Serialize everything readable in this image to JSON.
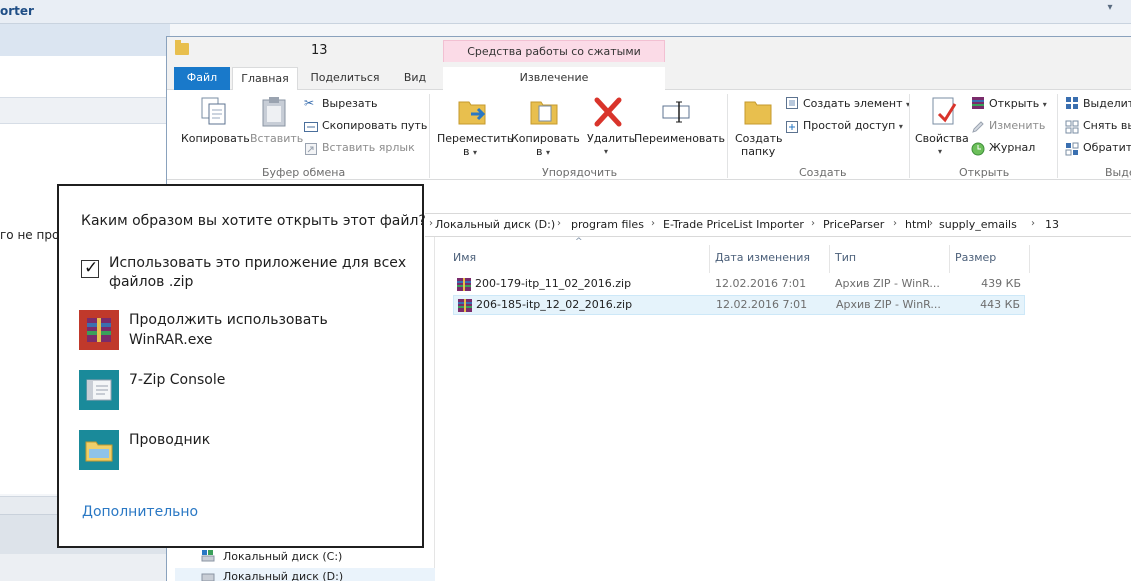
{
  "background_app": {
    "title": "orter",
    "truncated_text": "го не про"
  },
  "explorer": {
    "title": "13",
    "context_tab_header": "Средства работы со сжатыми папками",
    "tabs": {
      "file": "Файл",
      "home": "Главная",
      "share": "Поделиться",
      "view": "Вид",
      "extract": "Извлечение"
    },
    "ribbon": {
      "clipboard": {
        "copy": "Копировать",
        "paste": "Вставить",
        "cut": "Вырезать",
        "copy_path": "Скопировать путь",
        "paste_shortcut": "Вставить ярлык",
        "group": "Буфер обмена"
      },
      "organize": {
        "move_to_line1": "Переместить",
        "move_to_line2": "в",
        "copy_to_line1": "Копировать",
        "copy_to_line2": "в",
        "delete": "Удалить",
        "rename": "Переименовать",
        "group": "Упорядочить"
      },
      "create": {
        "new_folder_line1": "Создать",
        "new_folder_line2": "папку",
        "new_item": "Создать элемент",
        "easy_access": "Простой доступ",
        "group": "Создать"
      },
      "open": {
        "properties": "Свойства",
        "open": "Открыть",
        "edit": "Изменить",
        "history": "Журнал",
        "group": "Открыть"
      },
      "select": {
        "select_all": "Выделить",
        "select_none": "Снять вы",
        "invert": "Обратить",
        "group": "Выде"
      }
    },
    "breadcrumb": [
      "Локальный диск (D:)",
      "program files",
      "E-Trade PriceList Importer",
      "PriceParser",
      "html",
      "supply_emails",
      "13"
    ],
    "columns": {
      "name": "Имя",
      "date": "Дата изменения",
      "type": "Тип",
      "size": "Размер"
    },
    "files": [
      {
        "name": "200-179-itp_11_02_2016.zip",
        "date": "12.02.2016 7:01",
        "type": "Архив ZIP - WinR...",
        "size": "439 КБ"
      },
      {
        "name": "206-185-itp_12_02_2016.zip",
        "date": "12.02.2016 7:01",
        "type": "Архив ZIP - WinR...",
        "size": "443 КБ"
      }
    ],
    "nav": {
      "drive_c": "Локальный диск (C:)",
      "drive_d": "Локальный диск (D:)"
    }
  },
  "dialog": {
    "question": "Каким образом вы хотите открыть этот файл?",
    "always_use_label": "Использовать это приложение для всех файлов .zip",
    "always_use_checked": true,
    "apps": [
      {
        "name": "Продолжить использовать WinRAR.exe",
        "icon": "winrar-icon"
      },
      {
        "name": "7-Zip Console",
        "icon": "7zip-console-icon"
      },
      {
        "name": "Проводник",
        "icon": "explorer-icon"
      }
    ],
    "more_link": "Дополнительно"
  },
  "colors": {
    "file_tab": "#1979ca",
    "context_tab": "#fbdbe7",
    "link": "#2a78c4",
    "selection": "#e5f3fb",
    "app_tile": "#1a8a9a",
    "winrar_tile": "#c0392b"
  }
}
